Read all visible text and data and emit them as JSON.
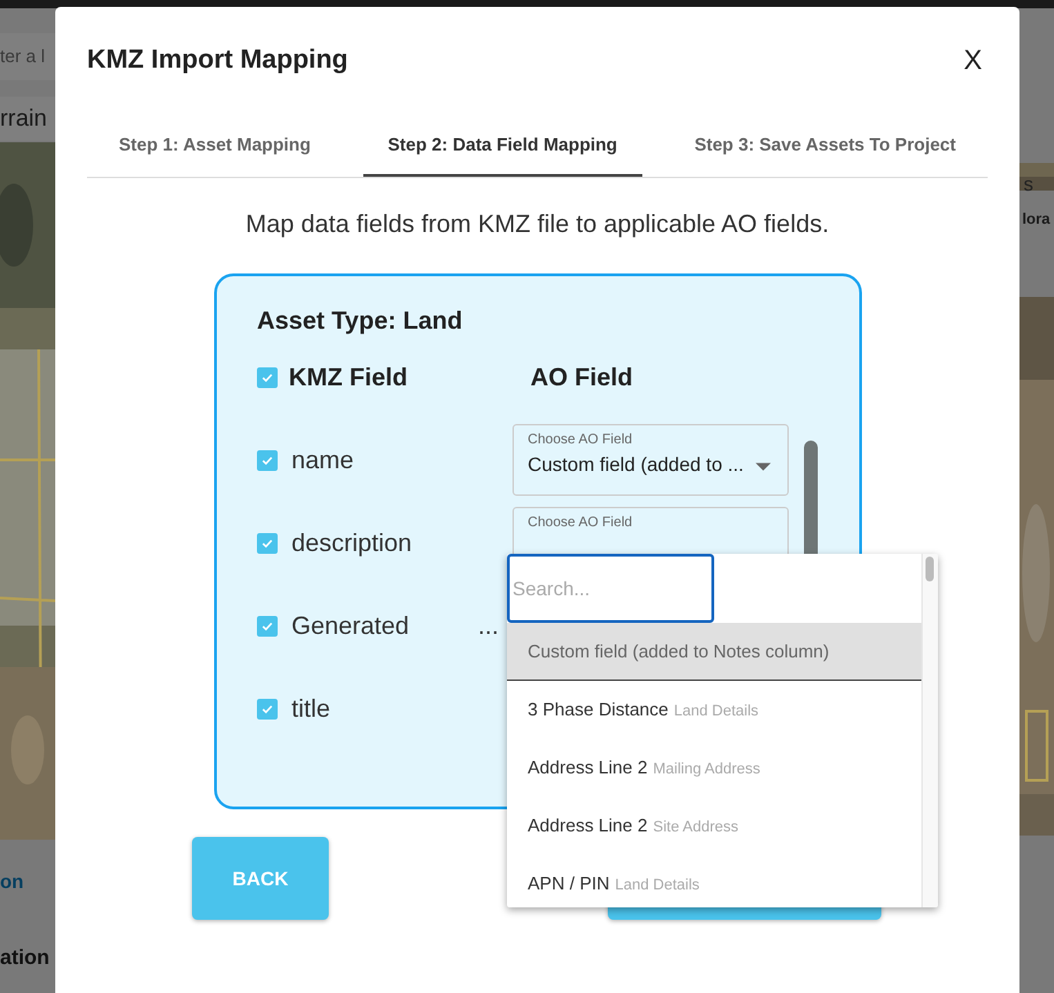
{
  "background": {
    "search_field": "ter a l",
    "map_button": "rrain",
    "column_header": "s",
    "table_cell": "lora",
    "tab": "on",
    "heading": "ation"
  },
  "dialog": {
    "title": "KMZ Import Mapping",
    "close": "X",
    "steps": [
      {
        "label": "Step 1: Asset Mapping",
        "selected": false
      },
      {
        "label": "Step 2: Data Field Mapping",
        "selected": true
      },
      {
        "label": "Step 3: Save Assets To Project",
        "selected": false
      }
    ],
    "instruction": "Map data fields from KMZ file to applicable AO fields.",
    "card": {
      "asset_type": "Asset Type: Land",
      "all_checked": true,
      "kmz_header": "KMZ Field",
      "ao_header": "AO Field",
      "rows": [
        {
          "name": "name",
          "checked": true,
          "select_label": "Choose AO Field",
          "select_value": "Custom field (added to ..."
        },
        {
          "name": "description",
          "checked": true,
          "select_label": "Choose AO Field"
        },
        {
          "name": "Generated",
          "checked": true,
          "more": "..."
        },
        {
          "name": "title",
          "checked": true
        }
      ]
    },
    "dropdown": {
      "placeholder": "Search...",
      "options": [
        {
          "label": "Custom field (added to Notes column)",
          "selected": true
        },
        {
          "label": "3 Phase Distance",
          "group": "Land Details",
          "selected": false
        },
        {
          "label": "Address Line 2",
          "group": "Mailing Address",
          "selected": false
        },
        {
          "label": "Address Line 2",
          "group": "Site Address",
          "selected": false
        },
        {
          "label": "APN / PIN",
          "group": "Land Details",
          "selected": false
        }
      ]
    },
    "back_button": "BACK"
  }
}
